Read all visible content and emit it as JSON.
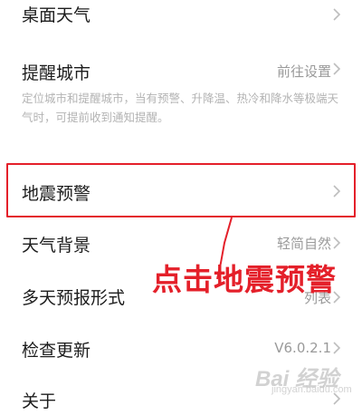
{
  "settings": {
    "items": [
      {
        "label": "桌面天气",
        "value": ""
      },
      {
        "label": "提醒城市",
        "value": "前往设置"
      },
      {
        "label": "地震预警",
        "value": ""
      },
      {
        "label": "天气背景",
        "value": "轻简自然"
      },
      {
        "label": "多天预报形式",
        "value": "列表"
      },
      {
        "label": "检查更新",
        "value": "V6.0.2.1"
      },
      {
        "label": "关于",
        "value": ""
      }
    ],
    "reminder_description": "定位城市和提醒城市，当有预警、升降温、热冷和降水等极端天气时，可提前收到通知提醒。"
  },
  "annotation": {
    "text": "点击地震预警",
    "color": "#e4202a"
  },
  "watermark": {
    "text": "Bai 经验",
    "sub": "jingyan.baidu.com"
  },
  "colors": {
    "primary_text": "#1c1c1c",
    "secondary_text": "#9a9a9a",
    "highlight": "#e4202a"
  }
}
